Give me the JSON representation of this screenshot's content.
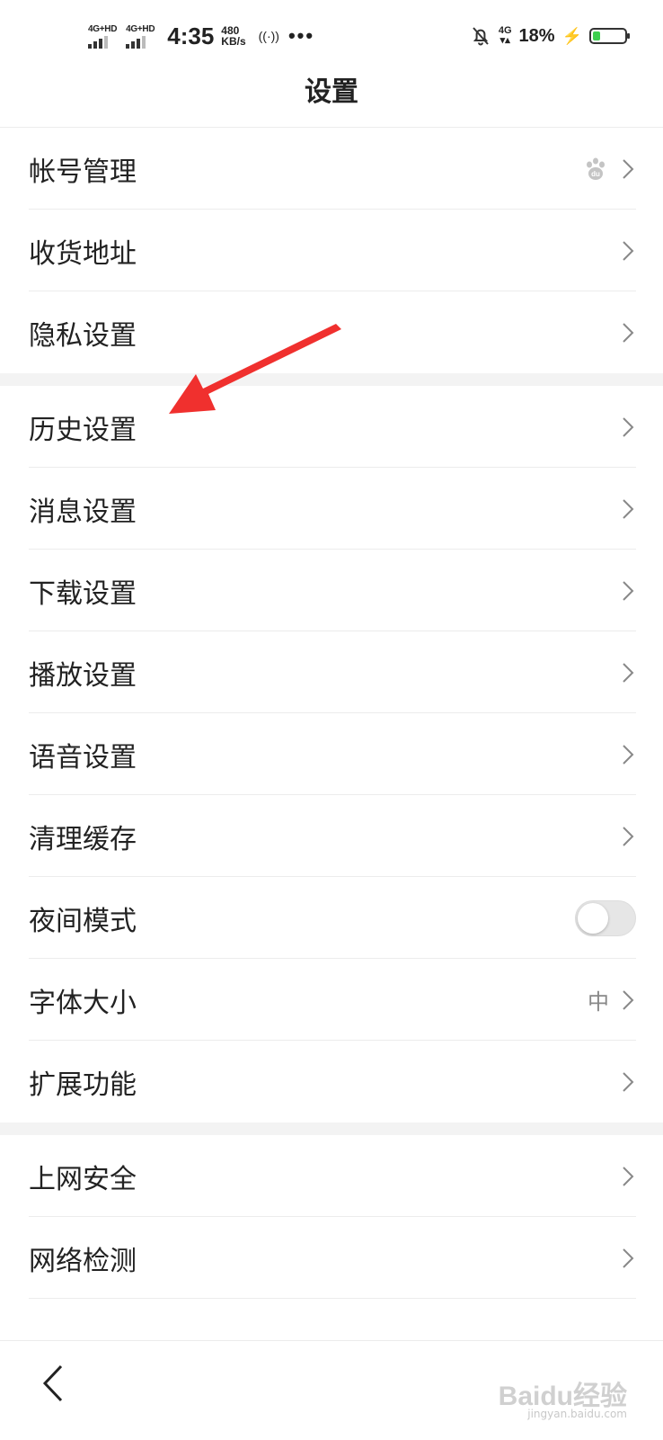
{
  "status_bar": {
    "sim1_label": "4G+HD",
    "sim2_label": "4G+HD",
    "time": "4:35",
    "speed_value": "480",
    "speed_unit": "KB/s",
    "hotspot_glyph": "((·))",
    "more_glyph": "•••",
    "network_label": "4G",
    "battery_percent": "18%",
    "battery_level": 0.18,
    "icons": [
      "signal-icon",
      "hotspot-icon",
      "mute-bell-icon",
      "charging-icon",
      "battery-icon"
    ]
  },
  "header": {
    "title": "设置"
  },
  "sections": [
    {
      "items": [
        {
          "label": "帐号管理",
          "trailing_icon": "baidu-paw-icon"
        },
        {
          "label": "收货地址"
        },
        {
          "label": "隐私设置"
        }
      ]
    },
    {
      "items": [
        {
          "label": "历史设置"
        },
        {
          "label": "消息设置"
        },
        {
          "label": "下载设置"
        },
        {
          "label": "播放设置"
        },
        {
          "label": "语音设置"
        },
        {
          "label": "清理缓存"
        },
        {
          "label": "夜间模式",
          "toggle_on": false
        },
        {
          "label": "字体大小",
          "value": "中"
        },
        {
          "label": "扩展功能"
        }
      ]
    },
    {
      "items": [
        {
          "label": "上网安全"
        },
        {
          "label": "网络检测"
        }
      ]
    }
  ],
  "bottom_bar": {
    "back_icon": "back-chevron-icon",
    "watermark": "Baidu经验",
    "watermark_sub": "jingyan.baidu.com"
  },
  "annotation": {
    "arrow_color": "#f0302e"
  }
}
